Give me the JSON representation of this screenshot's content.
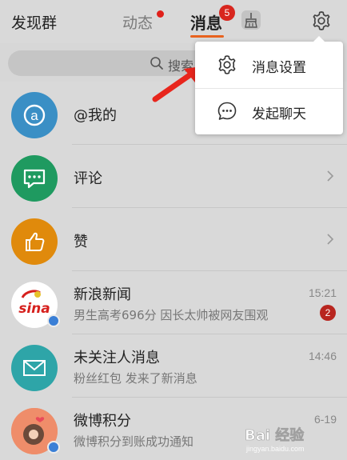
{
  "header": {
    "tab_discover": "发现群",
    "tab_dynamic": "动态",
    "tab_messages": "消息",
    "messages_badge": "5"
  },
  "search": {
    "placeholder": "搜索"
  },
  "menu": {
    "items": [
      {
        "label": "消息设置",
        "icon": "gear-icon"
      },
      {
        "label": "发起聊天",
        "icon": "chat-bubble-icon"
      }
    ]
  },
  "list": [
    {
      "title": "@我的",
      "icon": "at-icon",
      "color": "#3a8fc5"
    },
    {
      "title": "评论",
      "icon": "comment-icon",
      "color": "#1f9a60"
    },
    {
      "title": "赞",
      "icon": "thumbs-up-icon",
      "color": "#e08a0c"
    },
    {
      "title": "新浪新闻",
      "subtitle": "男生高考696分 因长太帅被网友围观",
      "time": "15:21",
      "unread": "2"
    },
    {
      "title": "未关注人消息",
      "subtitle": "粉丝红包 发来了新消息",
      "time": "14:46",
      "icon": "envelope-icon",
      "color": "#2ea5a8"
    },
    {
      "title": "微博积分",
      "subtitle": "微博积分到账成功通知",
      "time": "6-19"
    }
  ],
  "colors": {
    "accent_orange": "#e8621e",
    "badge_red": "#d8261e"
  },
  "watermark": {
    "logo": "Bai 经验",
    "url": "jingyan.baidu.com"
  }
}
